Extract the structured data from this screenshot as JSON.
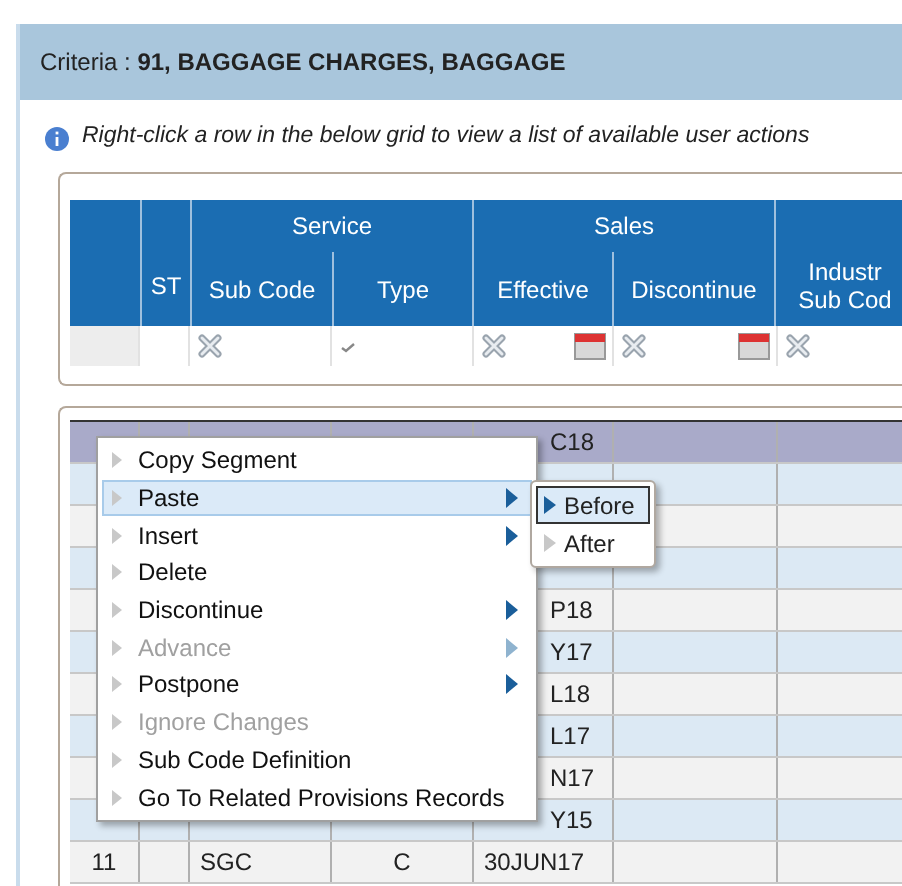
{
  "header": {
    "label": "Criteria : ",
    "value": "91, BAGGAGE CHARGES, BAGGAGE"
  },
  "info": "Right-click a row in the below grid to view a list of available user actions",
  "headers": [
    {
      "kind": "blank"
    },
    {
      "kind": "single",
      "label": "ST"
    },
    {
      "kind": "group",
      "label": "Service",
      "columns": [
        {
          "label": "Sub Code"
        },
        {
          "label": "Type"
        }
      ]
    },
    {
      "kind": "group",
      "label": "Sales",
      "columns": [
        {
          "label": "Effective"
        },
        {
          "label": "Discontinue"
        }
      ]
    },
    {
      "kind": "single",
      "label": "Industr\nSub Cod"
    }
  ],
  "filters": [
    {
      "kind": "blank"
    },
    {
      "kind": "blank"
    },
    {
      "kind": "clear"
    },
    {
      "kind": "check"
    },
    {
      "kind": "date"
    },
    {
      "kind": "date"
    },
    {
      "kind": "clear"
    }
  ],
  "rows": [
    {
      "selected": true,
      "effective_fragment": "C18"
    },
    {
      "selected": false
    },
    {
      "selected": false
    },
    {
      "selected": false
    },
    {
      "selected": false,
      "effective_fragment": "P18"
    },
    {
      "selected": false,
      "effective_fragment": "Y17"
    },
    {
      "selected": false,
      "effective_fragment": "L18"
    },
    {
      "selected": false,
      "effective_fragment": "L17"
    },
    {
      "selected": false,
      "effective_fragment": "N17"
    },
    {
      "selected": false,
      "effective_fragment": "Y15"
    },
    {
      "selected": false,
      "num": "11",
      "sub_code": "SGC",
      "type": "C",
      "effective": "30JUN17"
    }
  ],
  "context_menu": {
    "items": [
      {
        "label": "Copy Segment",
        "disabled": false,
        "has_submenu": false,
        "selected": false
      },
      {
        "label": "Paste",
        "disabled": false,
        "has_submenu": true,
        "selected": true
      },
      {
        "label": "Insert",
        "disabled": false,
        "has_submenu": true,
        "selected": false
      },
      {
        "label": "Delete",
        "disabled": false,
        "has_submenu": false,
        "selected": false
      },
      {
        "label": "Discontinue",
        "disabled": false,
        "has_submenu": true,
        "selected": false
      },
      {
        "label": "Advance",
        "disabled": true,
        "has_submenu": true,
        "selected": false
      },
      {
        "label": "Postpone",
        "disabled": false,
        "has_submenu": true,
        "selected": false
      },
      {
        "label": "Ignore Changes",
        "disabled": true,
        "has_submenu": false,
        "selected": false
      },
      {
        "label": "Sub Code Definition",
        "disabled": false,
        "has_submenu": false,
        "selected": false
      },
      {
        "label": "Go To Related Provisions Records",
        "disabled": false,
        "has_submenu": false,
        "selected": false
      }
    ]
  },
  "submenu": {
    "items": [
      {
        "label": "Before",
        "selected": true
      },
      {
        "label": "After",
        "selected": false
      }
    ]
  }
}
